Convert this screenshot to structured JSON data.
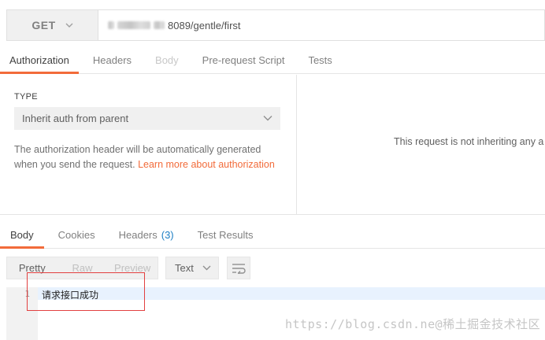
{
  "request": {
    "method": "GET",
    "url_visible": "8089/gentle/first"
  },
  "request_tabs": [
    {
      "label": "Authorization",
      "state": "active"
    },
    {
      "label": "Headers",
      "state": "normal"
    },
    {
      "label": "Body",
      "state": "disabled"
    },
    {
      "label": "Pre-request Script",
      "state": "normal"
    },
    {
      "label": "Tests",
      "state": "normal"
    }
  ],
  "auth": {
    "type_label": "TYPE",
    "type_value": "Inherit auth from parent",
    "description": "The authorization header will be automatically generated when you send the request.",
    "link_text": "Learn more about authorization",
    "right_message": "This request is not inheriting any a"
  },
  "response_tabs": [
    {
      "label": "Body",
      "state": "active"
    },
    {
      "label": "Cookies",
      "state": "normal"
    },
    {
      "label": "Headers",
      "count": "(3)",
      "state": "normal"
    },
    {
      "label": "Test Results",
      "state": "normal"
    }
  ],
  "view_modes": {
    "pretty": "Pretty",
    "raw": "Raw",
    "preview": "Preview"
  },
  "format": "Text",
  "body": {
    "line_number": "1",
    "content": "请求接口成功"
  },
  "watermark": "https://blog.csdn.ne@稀土掘金技术社区",
  "colors": {
    "accent": "#f26b3a",
    "count": "#1d7fc4",
    "highlight_box": "#e24040"
  }
}
